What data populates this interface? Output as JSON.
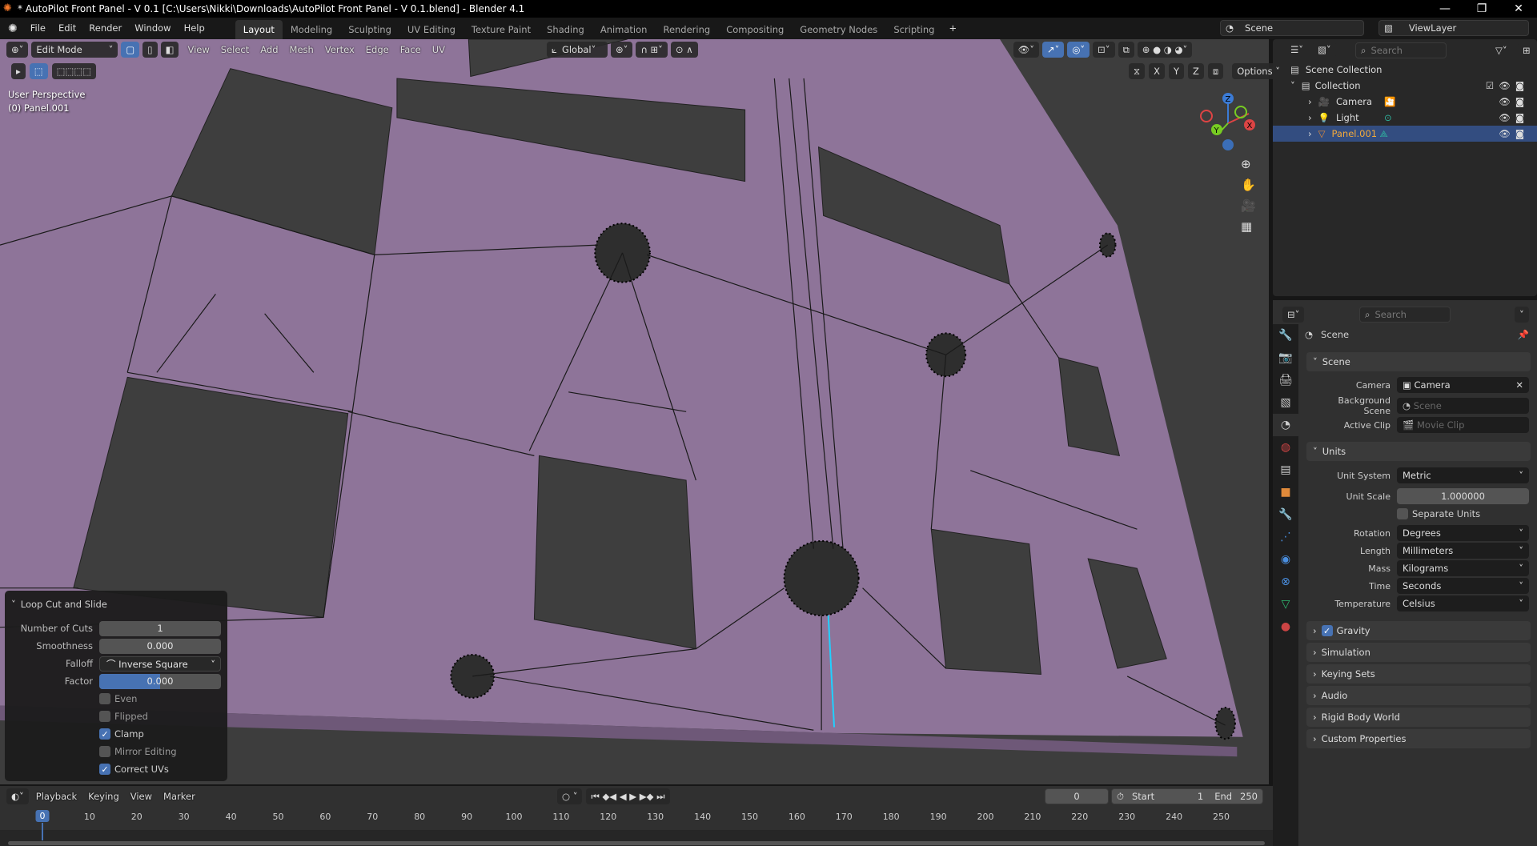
{
  "title": "* AutoPilot Front Panel - V 0.1 [C:\\Users\\Nikki\\Downloads\\AutoPilot Front Panel - V 0.1.blend] - Blender 4.1",
  "menu": [
    "File",
    "Edit",
    "Render",
    "Window",
    "Help"
  ],
  "workspaces": [
    "Layout",
    "Modeling",
    "Sculpting",
    "UV Editing",
    "Texture Paint",
    "Shading",
    "Animation",
    "Rendering",
    "Compositing",
    "Geometry Nodes",
    "Scripting"
  ],
  "active_workspace": "Layout",
  "scene_name": "Scene",
  "view_layer": "ViewLayer",
  "viewport": {
    "mode": "Edit Mode",
    "menus": [
      "View",
      "Select",
      "Add",
      "Mesh",
      "Vertex",
      "Edge",
      "Face",
      "UV"
    ],
    "orientation": "Global",
    "options": "Options",
    "axis_toggles": [
      "X",
      "Y",
      "Z"
    ],
    "info_line1": "User Perspective",
    "info_line2": "(0) Panel.001",
    "gizmo": {
      "x": "X",
      "y": "Y",
      "z": "Z"
    },
    "mesh_color": "#8e7499"
  },
  "operator_panel": {
    "title": "Loop Cut and Slide",
    "number_of_cuts_label": "Number of Cuts",
    "number_of_cuts": "1",
    "smoothness_label": "Smoothness",
    "smoothness": "0.000",
    "falloff_label": "Falloff",
    "falloff": "Inverse Square",
    "factor_label": "Factor",
    "factor": "0.000",
    "factor_fill": 0.5,
    "checks": [
      {
        "label": "Even",
        "checked": false
      },
      {
        "label": "Flipped",
        "checked": false
      },
      {
        "label": "Clamp",
        "checked": true
      },
      {
        "label": "Mirror Editing",
        "checked": false
      },
      {
        "label": "Correct UVs",
        "checked": true
      }
    ]
  },
  "outliner": {
    "search_placeholder": "Search",
    "root": "Scene Collection",
    "collection": "Collection",
    "items": [
      {
        "name": "Camera",
        "icon": "camera-icon"
      },
      {
        "name": "Light",
        "icon": "light-icon"
      },
      {
        "name": "Panel.001",
        "icon": "mesh-icon",
        "selected": true
      }
    ]
  },
  "properties": {
    "search_placeholder": "Search",
    "context": "Scene",
    "scene_panel": "Scene",
    "camera_label": "Camera",
    "camera": "Camera",
    "bg_scene_label": "Background Scene",
    "bg_scene_placeholder": "Scene",
    "active_clip_label": "Active Clip",
    "active_clip_placeholder": "Movie Clip",
    "units_panel": "Units",
    "unit_system_label": "Unit System",
    "unit_system": "Metric",
    "unit_scale_label": "Unit Scale",
    "unit_scale": "1.000000",
    "separate_units": "Separate Units",
    "rotation_label": "Rotation",
    "rotation": "Degrees",
    "length_label": "Length",
    "length": "Millimeters",
    "mass_label": "Mass",
    "mass": "Kilograms",
    "time_label": "Time",
    "time": "Seconds",
    "temperature_label": "Temperature",
    "temperature": "Celsius",
    "collapsed": [
      {
        "label": "Gravity",
        "checkbox": true
      },
      {
        "label": "Simulation"
      },
      {
        "label": "Keying Sets"
      },
      {
        "label": "Audio"
      },
      {
        "label": "Rigid Body World"
      },
      {
        "label": "Custom Properties"
      }
    ]
  },
  "timeline": {
    "menus": [
      "Playback",
      "Keying",
      "View",
      "Marker"
    ],
    "current_frame": "0",
    "start_label": "Start",
    "start": "1",
    "end_label": "End",
    "end": "250",
    "ticks": [
      "0",
      "10",
      "20",
      "30",
      "40",
      "50",
      "60",
      "70",
      "80",
      "90",
      "100",
      "110",
      "120",
      "130",
      "140",
      "150",
      "160",
      "170",
      "180",
      "190",
      "200",
      "210",
      "220",
      "230",
      "240",
      "250"
    ]
  }
}
